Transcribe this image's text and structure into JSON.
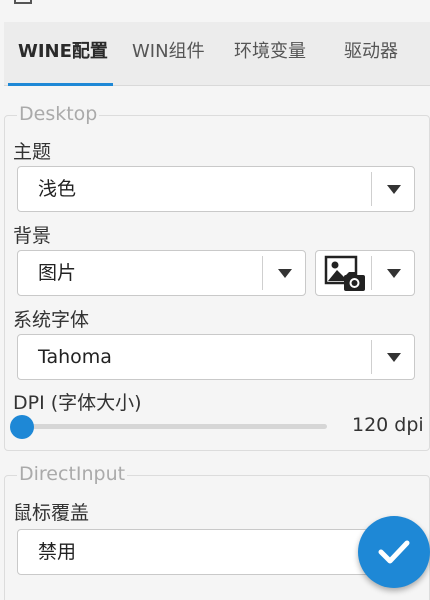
{
  "tabs": [
    {
      "label": "WINE配置",
      "active": true
    },
    {
      "label": "WIN组件",
      "active": false
    },
    {
      "label": "环境变量",
      "active": false
    },
    {
      "label": "驱动器",
      "active": false
    }
  ],
  "desktop": {
    "legend": "Desktop",
    "theme_label": "主题",
    "theme_value": "浅色",
    "background_label": "背景",
    "background_value": "图片",
    "background_icon": "image-camera-icon",
    "font_label": "系统字体",
    "font_value": "Tahoma",
    "dpi_label": "DPI (字体大小)",
    "dpi_value_text": "120 dpi",
    "dpi_slider_level": 0.0
  },
  "directinput": {
    "legend": "DirectInput",
    "mouse_label": "鼠标覆盖",
    "mouse_value": "禁用"
  },
  "fab": {
    "icon": "check-icon"
  },
  "colors": {
    "accent": "#1e88d6",
    "background": "#f5f5f5",
    "tabbar": "#ececec"
  }
}
